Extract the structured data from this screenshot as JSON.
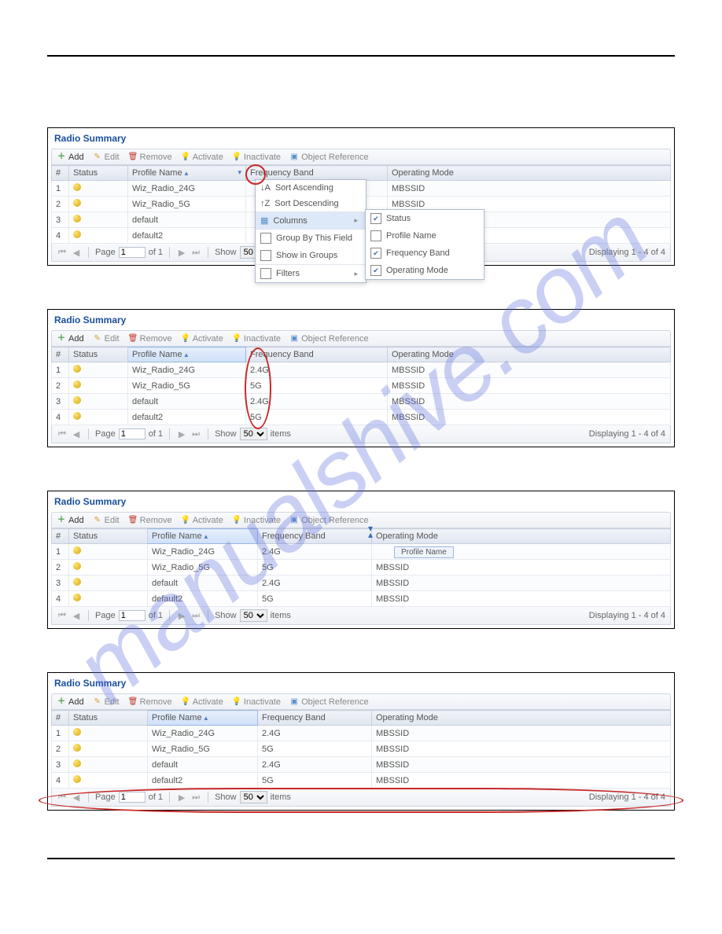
{
  "watermark_text": "manualshive.com",
  "toolbar": {
    "add": "Add",
    "edit": "Edit",
    "remove": "Remove",
    "activate": "Activate",
    "inactivate": "Inactivate",
    "objref": "Object Reference"
  },
  "columns": {
    "num": "#",
    "status": "Status",
    "profile": "Profile Name",
    "freq": "Frequency Band",
    "mode": "Operating Mode"
  },
  "ctx_menu": {
    "sort_asc": "Sort Ascending",
    "sort_desc": "Sort Descending",
    "columns": "Columns",
    "group_by": "Group By This Field",
    "show_groups": "Show in Groups",
    "filters": "Filters",
    "col_status": "Status",
    "col_profile": "Profile Name",
    "col_freq": "Frequency Band",
    "col_mode": "Operating Mode"
  },
  "pager": {
    "page": "Page",
    "page_val": "1",
    "of": "of 1",
    "show": "Show",
    "show_val": "50",
    "items": "items",
    "display": "Displaying 1 - 4 of 4"
  },
  "panel1": {
    "title": "Radio Summary",
    "rows": [
      {
        "n": "1",
        "p": "Wiz_Radio_24G",
        "f": "",
        "m": "MBSSID"
      },
      {
        "n": "2",
        "p": "Wiz_Radio_5G",
        "f": "",
        "m": "MBSSID"
      },
      {
        "n": "3",
        "p": "default",
        "f": "",
        "m": ""
      },
      {
        "n": "4",
        "p": "default2",
        "f": "",
        "m": ""
      }
    ]
  },
  "panel2": {
    "title": "Radio Summary",
    "rows": [
      {
        "n": "1",
        "p": "Wiz_Radio_24G",
        "f": "2.4G",
        "m": "MBSSID"
      },
      {
        "n": "2",
        "p": "Wiz_Radio_5G",
        "f": "5G",
        "m": "MBSSID"
      },
      {
        "n": "3",
        "p": "default",
        "f": "2.4G",
        "m": "MBSSID"
      },
      {
        "n": "4",
        "p": "default2",
        "f": "5G",
        "m": "MBSSID"
      }
    ]
  },
  "panel3": {
    "title": "Radio Summary",
    "drag_tip": "Profile Name",
    "rows": [
      {
        "n": "1",
        "p": "Wiz_Radio_24G",
        "f": "2.4G",
        "m": ""
      },
      {
        "n": "2",
        "p": "Wiz_Radio_5G",
        "f": "5G",
        "m": "MBSSID"
      },
      {
        "n": "3",
        "p": "default",
        "f": "2.4G",
        "m": "MBSSID"
      },
      {
        "n": "4",
        "p": "default2",
        "f": "5G",
        "m": "MBSSID"
      }
    ]
  },
  "panel4": {
    "title": "Radio Summary",
    "rows": [
      {
        "n": "1",
        "p": "Wiz_Radio_24G",
        "f": "2.4G",
        "m": "MBSSID"
      },
      {
        "n": "2",
        "p": "Wiz_Radio_5G",
        "f": "5G",
        "m": "MBSSID"
      },
      {
        "n": "3",
        "p": "default",
        "f": "2.4G",
        "m": "MBSSID"
      },
      {
        "n": "4",
        "p": "default2",
        "f": "5G",
        "m": "MBSSID"
      }
    ]
  }
}
